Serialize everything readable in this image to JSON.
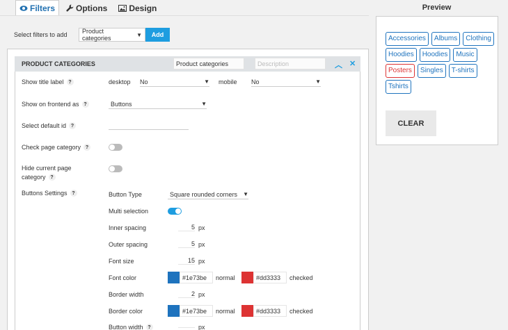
{
  "tabs": [
    {
      "label": "Filters",
      "icon": "eye-icon"
    },
    {
      "label": "Options",
      "icon": "wrench-icon"
    },
    {
      "label": "Design",
      "icon": "image-icon"
    }
  ],
  "select_filters": {
    "label": "Select filters to add",
    "value": "Product categories",
    "add_label": "Add"
  },
  "filter": {
    "title": "PRODUCT CATEGORIES",
    "name_value": "Product categories",
    "description_placeholder": "Description",
    "show_title_label": {
      "label": "Show title label",
      "desktop_label": "desktop",
      "desktop_value": "No",
      "mobile_label": "mobile",
      "mobile_value": "No"
    },
    "show_on_frontend": {
      "label": "Show on frontend as",
      "value": "Buttons"
    },
    "select_default_id": {
      "label": "Select default id",
      "value": ""
    },
    "check_page_category": {
      "label": "Check page category",
      "on": false
    },
    "hide_current_page_category": {
      "label_line1": "Hide current page",
      "label_line2": "category",
      "on": false
    },
    "buttons_settings": {
      "label": "Buttons Settings",
      "button_type_label": "Button Type",
      "button_type_value": "Square rounded corners",
      "multi_selection_label": "Multi selection",
      "multi_selection_on": true,
      "inner_spacing_label": "Inner spacing",
      "inner_spacing_value": "5",
      "inner_spacing_unit": "px",
      "outer_spacing_label": "Outer spacing",
      "outer_spacing_value": "5",
      "outer_spacing_unit": "px",
      "font_size_label": "Font size",
      "font_size_value": "15",
      "font_size_unit": "px",
      "font_color_label": "Font color",
      "font_color_normal": "#1e73be",
      "font_color_normal_label": "normal",
      "font_color_checked": "#dd3333",
      "font_color_checked_label": "checked",
      "border_width_label": "Border width",
      "border_width_value": "2",
      "border_width_unit": "px",
      "border_color_label": "Border color",
      "border_color_normal": "#1e73be",
      "border_color_normal_label": "normal",
      "border_color_checked": "#dd3333",
      "border_color_checked_label": "checked",
      "button_width_label": "Button width",
      "button_width_value": "",
      "button_width_unit": "px"
    }
  },
  "preview": {
    "title": "Preview",
    "chips": [
      {
        "label": "Accessories",
        "checked": false
      },
      {
        "label": "Albums",
        "checked": false
      },
      {
        "label": "Clothing",
        "checked": false
      },
      {
        "label": "Hoodies",
        "checked": false
      },
      {
        "label": "Hoodies",
        "checked": false
      },
      {
        "label": "Music",
        "checked": false
      },
      {
        "label": "Posters",
        "checked": true
      },
      {
        "label": "Singles",
        "checked": false
      },
      {
        "label": "T-shirts",
        "checked": false
      },
      {
        "label": "Tshirts",
        "checked": false
      }
    ],
    "clear_label": "CLEAR"
  },
  "colors": {
    "accent": "#1e9de0",
    "normal": "#1e73be",
    "checked": "#dd3333"
  }
}
